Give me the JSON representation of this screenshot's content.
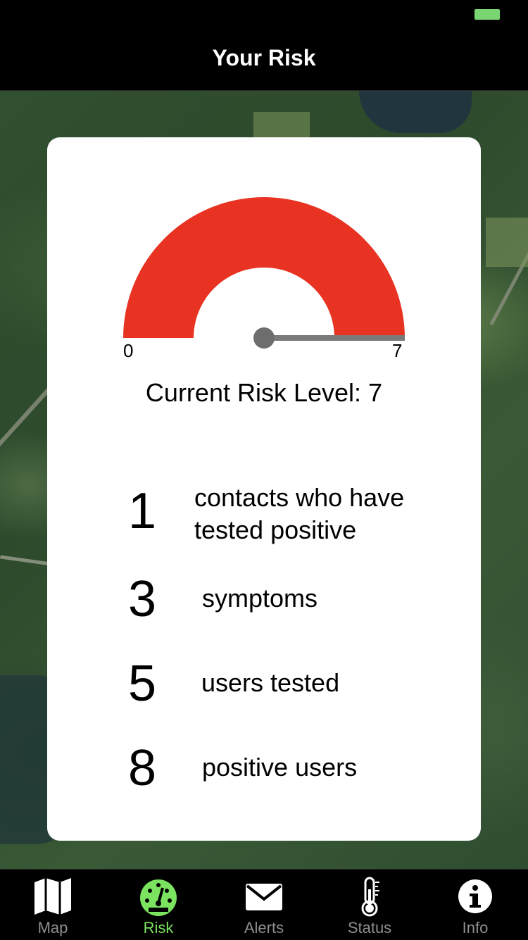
{
  "nav": {
    "title": "Your Risk"
  },
  "gauge": {
    "min_label": "0",
    "max_label": "7",
    "value": 7,
    "max": 7,
    "fill_color": "#e83323"
  },
  "risk": {
    "level_text": "Current Risk Level: 7"
  },
  "stats": [
    {
      "value": "1",
      "label_line1": "contacts who have",
      "label_line2": "tested positive"
    },
    {
      "value": "3",
      "label": "symptoms"
    },
    {
      "value": "5",
      "label": "users tested"
    },
    {
      "value": "8",
      "label": "positive users"
    }
  ],
  "tabs": [
    {
      "label": "Map",
      "icon": "map-icon"
    },
    {
      "label": "Risk",
      "icon": "gauge-icon",
      "active": true
    },
    {
      "label": "Alerts",
      "icon": "envelope-icon"
    },
    {
      "label": "Status",
      "icon": "thermometer-icon"
    },
    {
      "label": "Info",
      "icon": "info-icon"
    }
  ],
  "colors": {
    "accent": "#7be35f",
    "gauge_red": "#e83323",
    "battery": "#7ad673"
  }
}
